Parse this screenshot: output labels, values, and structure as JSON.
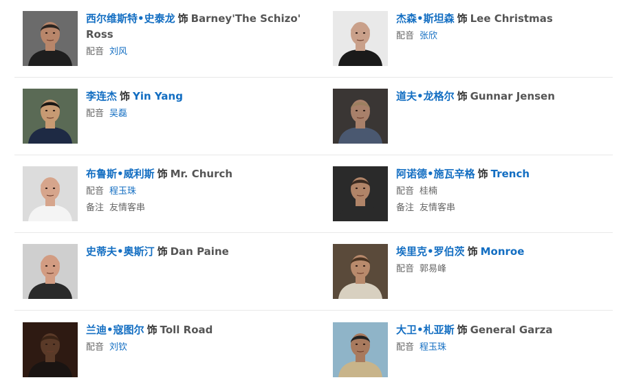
{
  "cast": [
    {
      "actor": "西尔维斯特•史泰龙",
      "shi": "饰",
      "character": "Barney'The Schizo' Ross",
      "character_linked": false,
      "dub_label": "配音",
      "dub": "刘风",
      "dub_linked": true,
      "note_label": "",
      "note": ""
    },
    {
      "actor": "杰森•斯坦森",
      "shi": "饰",
      "character": "Lee Christmas",
      "character_linked": false,
      "dub_label": "配音",
      "dub": "张欣",
      "dub_linked": true,
      "note_label": "",
      "note": ""
    },
    {
      "actor": "李连杰",
      "shi": "饰",
      "character": "Yin Yang",
      "character_linked": true,
      "dub_label": "配音",
      "dub": "吴磊",
      "dub_linked": true,
      "note_label": "",
      "note": ""
    },
    {
      "actor": "道夫•龙格尔",
      "shi": "饰",
      "character": "Gunnar Jensen",
      "character_linked": false,
      "dub_label": "",
      "dub": "",
      "dub_linked": false,
      "note_label": "",
      "note": ""
    },
    {
      "actor": "布鲁斯•威利斯",
      "shi": "饰",
      "character": "Mr. Church",
      "character_linked": false,
      "dub_label": "配音",
      "dub": "程玉珠",
      "dub_linked": true,
      "note_label": "备注",
      "note": "友情客串"
    },
    {
      "actor": "阿诺德•施瓦辛格",
      "shi": "饰",
      "character": "Trench",
      "character_linked": true,
      "dub_label": "配音",
      "dub": "桂楠",
      "dub_linked": false,
      "note_label": "备注",
      "note": "友情客串"
    },
    {
      "actor": "史蒂夫•奥斯汀",
      "shi": "饰",
      "character": "Dan Paine",
      "character_linked": false,
      "dub_label": "",
      "dub": "",
      "dub_linked": false,
      "note_label": "",
      "note": ""
    },
    {
      "actor": "埃里克•罗伯茨",
      "shi": "饰",
      "character": "Monroe",
      "character_linked": true,
      "dub_label": "配音",
      "dub": "郭易峰",
      "dub_linked": false,
      "note_label": "",
      "note": ""
    },
    {
      "actor": "兰迪•寇图尔",
      "shi": "饰",
      "character": "Toll Road",
      "character_linked": false,
      "dub_label": "配音",
      "dub": "刘钦",
      "dub_linked": true,
      "note_label": "",
      "note": ""
    },
    {
      "actor": "大卫•札亚斯",
      "shi": "饰",
      "character": "General Garza",
      "character_linked": false,
      "dub_label": "配音",
      "dub": "程玉珠",
      "dub_linked": true,
      "note_label": "",
      "note": ""
    }
  ],
  "colors": {
    "link": "#136ec2",
    "text": "#333333",
    "muted": "#666666",
    "divider": "#e8e8e8"
  }
}
